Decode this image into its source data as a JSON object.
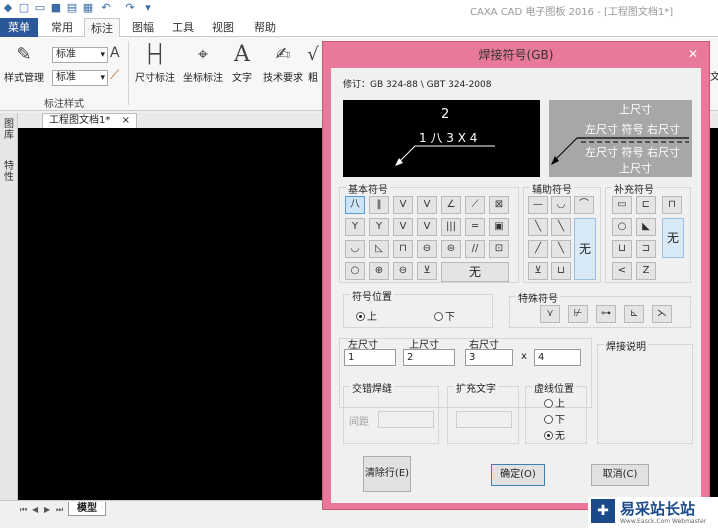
{
  "window": {
    "title": "CAXA CAD 电子图板 2016 - [工程图文档1*]"
  },
  "quick_access": {
    "icons": [
      "app-logo-icon",
      "new-file-icon",
      "open-folder-icon",
      "save-icon",
      "print-preview-icon",
      "print-icon",
      "undo-icon",
      "redo-icon",
      "customize-icon"
    ],
    "glyphs": [
      "◆",
      "▢",
      "▭",
      "■",
      "▤",
      "▦",
      "↶",
      "↷",
      "▾"
    ]
  },
  "ribbon": {
    "tabs": [
      {
        "label": "菜单"
      },
      {
        "label": "常用"
      },
      {
        "label": "标注"
      },
      {
        "label": "图幅"
      },
      {
        "label": "工具"
      },
      {
        "label": "视图"
      },
      {
        "label": "帮助"
      }
    ],
    "active_tab": "标注",
    "style_manage_label": "样式管理",
    "style_select_1": "标准",
    "style_select_2": "标准",
    "group_style_label": "标注样式",
    "buttons": {
      "dim": "尺寸标注",
      "coord": "坐标标注",
      "text": "文字",
      "tech": "技术要求",
      "rough": "粗"
    },
    "right_edge_text": "文"
  },
  "document": {
    "tab_label": "工程图文档1*",
    "tab_close": "×",
    "side_tabs": [
      "图库",
      "特性"
    ],
    "model_tab": "模型",
    "nav_arrows": [
      "⏮",
      "◀",
      "▶",
      "⏭"
    ]
  },
  "dialog": {
    "title": "焊接符号(GB)",
    "close_glyph": "✕",
    "revision": "修订：GB 324-88 \\ GBT 324-2008",
    "preview": {
      "top_number": "2",
      "bottom_text": "1  八 3 X 4"
    },
    "legend": {
      "upper_size": "上尺寸",
      "row_top": "左尺寸 符号 右尺寸",
      "row_bottom": "左尺寸 符号 右尺寸",
      "lower_size": "上尺寸"
    },
    "basic_symbols": {
      "label": "基本符号",
      "none": "无",
      "glyphs": [
        "八",
        "‖",
        "V",
        "V",
        "∠",
        "⟋",
        "⊠",
        "Y",
        "Y",
        "V",
        "V",
        "|||",
        "═",
        "▣",
        "◡",
        "◺",
        "⊓",
        "⊖",
        "⊜",
        "//",
        "⊡",
        "○",
        "⊕",
        "⊖",
        "⊻"
      ]
    },
    "aux_symbols": {
      "label": "辅助符号",
      "none": "无",
      "glyphs": [
        "—",
        "◡",
        "⌒",
        "╲",
        "╲",
        "╱",
        "╲",
        "⊻",
        "⊔"
      ]
    },
    "supp_symbols": {
      "label": "补充符号",
      "none": "无",
      "glyphs": [
        "▭",
        "⊏",
        "⊓",
        "○",
        "◣",
        "⊔",
        "⊐",
        "<",
        "Z"
      ]
    },
    "position": {
      "label": "符号位置",
      "up": "上",
      "down": "下",
      "selected": "上"
    },
    "special_symbols": {
      "label": "特殊符号",
      "glyphs": [
        "⋎",
        "⊬",
        "⊶",
        "⊾",
        "⋋"
      ]
    },
    "sizes": {
      "left_label": "左尺寸",
      "left_value": "1",
      "up_label": "上尺寸",
      "up_value": "2",
      "right_label": "右尺寸",
      "right_value": "3",
      "x_label": "x",
      "x_value": "4"
    },
    "weld_desc_label": "焊接说明",
    "staggered": {
      "label": "交错焊缝",
      "gap_label": "间距"
    },
    "extend_text_label": "扩充文字",
    "dashed_position": {
      "label": "虚线位置",
      "up": "上",
      "down": "下",
      "none": "无",
      "selected": "无"
    },
    "buttons": {
      "clear": "清除行(E)",
      "ok": "确定(O)",
      "cancel": "取消(C)"
    }
  },
  "watermark": {
    "logo_glyph": "✚",
    "name": "易采站长站",
    "url": "Www.Easck.Com Webmaster"
  }
}
